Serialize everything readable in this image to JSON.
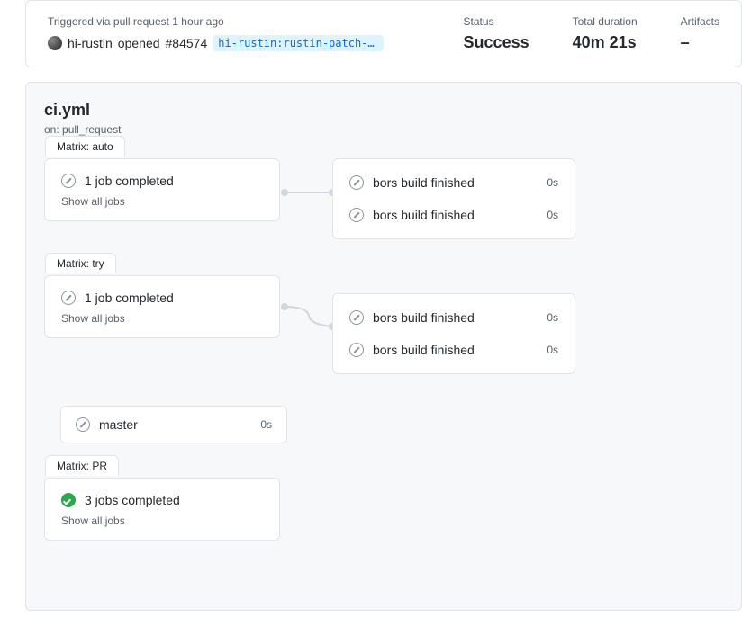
{
  "summary": {
    "trigger_text": "Triggered via pull request 1 hour ago",
    "user": "hi-rustin",
    "action": "opened",
    "pr": "#84574",
    "branch": "hi-rustin:rustin-patch-ty…",
    "status_label": "Status",
    "status_value": "Success",
    "duration_label": "Total duration",
    "duration_value": "40m 21s",
    "artifacts_label": "Artifacts",
    "artifacts_value": "–"
  },
  "workflow": {
    "title": "ci.yml",
    "on_label": "on:",
    "on_value": "pull_request"
  },
  "matrix_auto": {
    "tab": "Matrix: auto",
    "text": "1 job completed",
    "show_all": "Show all jobs"
  },
  "matrix_try": {
    "tab": "Matrix: try",
    "text": "1 job completed",
    "show_all": "Show all jobs"
  },
  "matrix_pr": {
    "tab": "Matrix: PR",
    "text": "3 jobs completed",
    "show_all": "Show all jobs"
  },
  "master_job": {
    "name": "master",
    "time": "0s"
  },
  "jobs_a": [
    {
      "name": "bors build finished",
      "time": "0s"
    },
    {
      "name": "bors build finished",
      "time": "0s"
    }
  ],
  "jobs_b": [
    {
      "name": "bors build finished",
      "time": "0s"
    },
    {
      "name": "bors build finished",
      "time": "0s"
    }
  ]
}
